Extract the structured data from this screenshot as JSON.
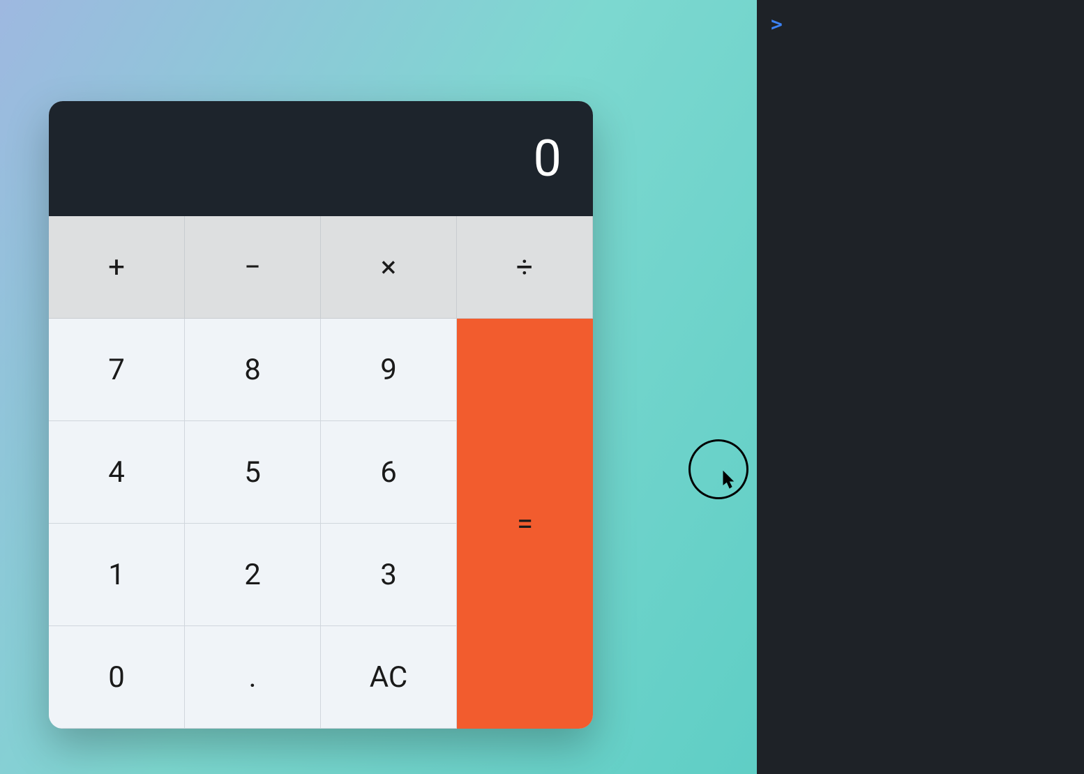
{
  "calculator": {
    "display_value": "0",
    "operators": {
      "add": "+",
      "subtract": "−",
      "multiply": "×",
      "divide": "÷"
    },
    "digits": {
      "seven": "7",
      "eight": "8",
      "nine": "9",
      "four": "4",
      "five": "5",
      "six": "6",
      "one": "1",
      "two": "2",
      "three": "3",
      "zero": "0",
      "decimal": "."
    },
    "actions": {
      "all_clear": "AC",
      "equals": "="
    }
  },
  "console": {
    "prompt": ">"
  }
}
